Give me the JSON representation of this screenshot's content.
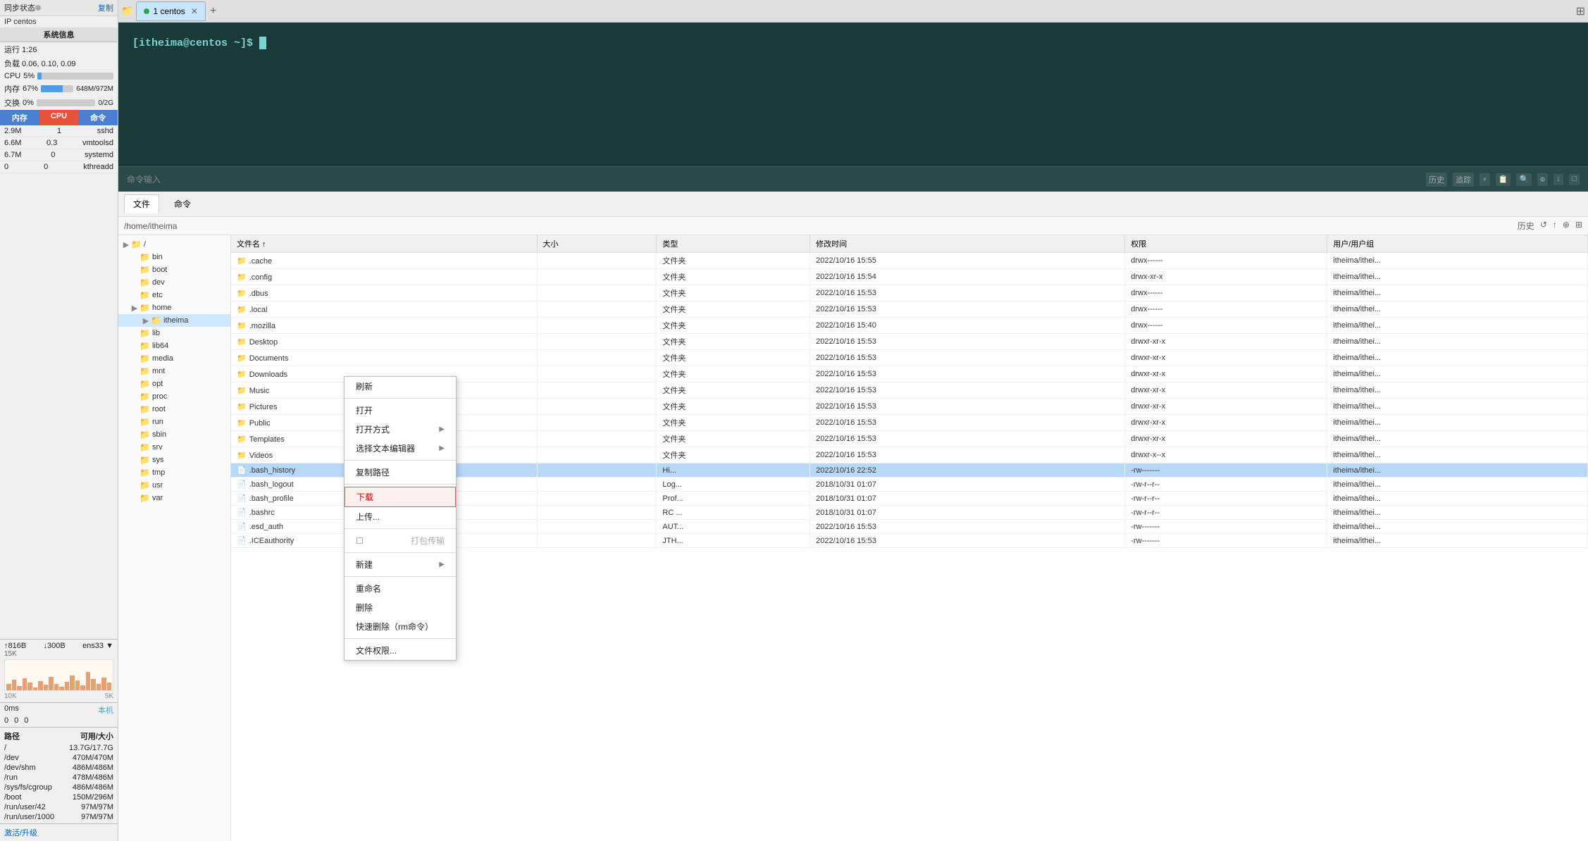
{
  "sidebar": {
    "header": {
      "title": "同步状态",
      "copy_label": "复制",
      "ip_label": "IP centos"
    },
    "sysinfo_label": "系统信息",
    "running": "运行 1:26",
    "load": "负载 0.06, 0.10, 0.09",
    "cpu_label": "CPU",
    "cpu_value": "5%",
    "mem_label": "内存",
    "mem_value": "67%",
    "mem_detail": "648M/972M",
    "swap_label": "交换",
    "swap_value": "0%",
    "swap_detail": "0/2G",
    "tabs": [
      "内存",
      "CPU",
      "命令"
    ],
    "active_tab": "CPU",
    "processes": [
      {
        "mem": "2.9M",
        "cpu": "1",
        "cmd": "sshd"
      },
      {
        "mem": "6.6M",
        "cpu": "0.3",
        "cmd": "vmtoolsd"
      },
      {
        "mem": "6.7M",
        "cpu": "0",
        "cmd": "systemd"
      },
      {
        "mem": "0",
        "cpu": "0",
        "cmd": "kthreadd"
      }
    ],
    "net": {
      "up": "↑816B",
      "down": "↓300B",
      "interface": "ens33",
      "chart_labels": [
        "15K",
        "10K",
        "5K"
      ]
    },
    "ping_label": "0ms",
    "ping_values": [
      "本机",
      "0",
      "0",
      "0"
    ],
    "disk_header": [
      "路径",
      "可用/大小"
    ],
    "disks": [
      {
        "path": "/",
        "size": "13.7G/17.7G"
      },
      {
        "path": "/dev",
        "size": "470M/470M"
      },
      {
        "path": "/dev/shm",
        "size": "486M/486M"
      },
      {
        "path": "/run",
        "size": "478M/486M"
      },
      {
        "path": "/sys/fs/cgroup",
        "size": "486M/486M"
      },
      {
        "path": "/boot",
        "size": "150M/296M"
      },
      {
        "path": "/run/user/42",
        "size": "97M/97M"
      },
      {
        "path": "/run/user/1000",
        "size": "97M/97M"
      }
    ],
    "bottom_label": "激活/升级"
  },
  "tab_bar": {
    "folder_icon": "📁",
    "active_tab": "1 centos",
    "tab_dot_color": "#28a745",
    "add_icon": "+",
    "grid_icon": "⊞"
  },
  "terminal": {
    "prompt": "[itheima@centos ~]$",
    "input_placeholder": "命令输入",
    "actions": {
      "history": "历史",
      "filter": "追踪"
    }
  },
  "file_manager": {
    "tabs": [
      "文件",
      "命令"
    ],
    "active_tab": "文件",
    "breadcrumb": "/home/itheima",
    "toolbar_buttons": [
      "历史",
      "↺",
      "↑",
      "⊕",
      "⊞"
    ],
    "tree": [
      {
        "name": "/",
        "level": 0,
        "toggle": "▶",
        "selected": false
      },
      {
        "name": "bin",
        "level": 1,
        "toggle": "",
        "selected": false
      },
      {
        "name": "boot",
        "level": 1,
        "toggle": "",
        "selected": false
      },
      {
        "name": "dev",
        "level": 1,
        "toggle": "",
        "selected": false
      },
      {
        "name": "etc",
        "level": 1,
        "toggle": "",
        "selected": false
      },
      {
        "name": "home",
        "level": 1,
        "toggle": "▶",
        "selected": false
      },
      {
        "name": "itheima",
        "level": 2,
        "toggle": "▶",
        "selected": true
      },
      {
        "name": "lib",
        "level": 1,
        "toggle": "",
        "selected": false
      },
      {
        "name": "lib64",
        "level": 1,
        "toggle": "",
        "selected": false
      },
      {
        "name": "media",
        "level": 1,
        "toggle": "",
        "selected": false
      },
      {
        "name": "mnt",
        "level": 1,
        "toggle": "",
        "selected": false
      },
      {
        "name": "opt",
        "level": 1,
        "toggle": "",
        "selected": false
      },
      {
        "name": "proc",
        "level": 1,
        "toggle": "",
        "selected": false
      },
      {
        "name": "root",
        "level": 1,
        "toggle": "",
        "selected": false
      },
      {
        "name": "run",
        "level": 1,
        "toggle": "",
        "selected": false
      },
      {
        "name": "sbin",
        "level": 1,
        "toggle": "",
        "selected": false
      },
      {
        "name": "srv",
        "level": 1,
        "toggle": "",
        "selected": false
      },
      {
        "name": "sys",
        "level": 1,
        "toggle": "",
        "selected": false
      },
      {
        "name": "tmp",
        "level": 1,
        "toggle": "",
        "selected": false
      },
      {
        "name": "usr",
        "level": 1,
        "toggle": "",
        "selected": false
      },
      {
        "name": "var",
        "level": 1,
        "toggle": "",
        "selected": false
      }
    ],
    "columns": [
      "文件名 ↑",
      "大小",
      "类型",
      "修改时间",
      "权限",
      "用户/用户组"
    ],
    "files": [
      {
        "name": ".cache",
        "size": "",
        "type": "文件夹",
        "modified": "2022/10/16 15:55",
        "perms": "drwx------",
        "owner": "itheima/ithei...",
        "selected": false
      },
      {
        "name": ".config",
        "size": "",
        "type": "文件夹",
        "modified": "2022/10/16 15:54",
        "perms": "drwx-xr-x",
        "owner": "itheima/ithei...",
        "selected": false
      },
      {
        "name": ".dbus",
        "size": "",
        "type": "文件夹",
        "modified": "2022/10/16 15:53",
        "perms": "drwx------",
        "owner": "itheima/ithei...",
        "selected": false
      },
      {
        "name": ".local",
        "size": "",
        "type": "文件夹",
        "modified": "2022/10/16 15:53",
        "perms": "drwx------",
        "owner": "itheima/ithei...",
        "selected": false
      },
      {
        "name": ".mozilla",
        "size": "",
        "type": "文件夹",
        "modified": "2022/10/16 15:40",
        "perms": "drwx------",
        "owner": "itheima/ithei...",
        "selected": false
      },
      {
        "name": "Desktop",
        "size": "",
        "type": "文件夹",
        "modified": "2022/10/16 15:53",
        "perms": "drwxr-xr-x",
        "owner": "itheima/ithei...",
        "selected": false
      },
      {
        "name": "Documents",
        "size": "",
        "type": "文件夹",
        "modified": "2022/10/16 15:53",
        "perms": "drwxr-xr-x",
        "owner": "itheima/ithei...",
        "selected": false
      },
      {
        "name": "Downloads",
        "size": "",
        "type": "文件夹",
        "modified": "2022/10/16 15:53",
        "perms": "drwxr-xr-x",
        "owner": "itheima/ithei...",
        "selected": false
      },
      {
        "name": "Music",
        "size": "",
        "type": "文件夹",
        "modified": "2022/10/16 15:53",
        "perms": "drwxr-xr-x",
        "owner": "itheima/ithei...",
        "selected": false
      },
      {
        "name": "Pictures",
        "size": "",
        "type": "文件夹",
        "modified": "2022/10/16 15:53",
        "perms": "drwxr-xr-x",
        "owner": "itheima/ithei...",
        "selected": false
      },
      {
        "name": "Public",
        "size": "",
        "type": "文件夹",
        "modified": "2022/10/16 15:53",
        "perms": "drwxr-xr-x",
        "owner": "itheima/ithei...",
        "selected": false
      },
      {
        "name": "Templates",
        "size": "",
        "type": "文件夹",
        "modified": "2022/10/16 15:53",
        "perms": "drwxr-xr-x",
        "owner": "itheima/ithei...",
        "selected": false
      },
      {
        "name": "Videos",
        "size": "",
        "type": "文件夹",
        "modified": "2022/10/16 15:53",
        "perms": "drwxr-x--x",
        "owner": "itheima/ithei...",
        "selected": false
      },
      {
        "name": ".bash_history",
        "size": "",
        "type": "Hi...",
        "modified": "2022/10/16 22:52",
        "perms": "-rw-------",
        "owner": "itheima/ithei...",
        "selected": true
      },
      {
        "name": ".bash_logout",
        "size": "",
        "type": "Log...",
        "modified": "2018/10/31 01:07",
        "perms": "-rw-r--r--",
        "owner": "itheima/ithei...",
        "selected": false
      },
      {
        "name": ".bash_profile",
        "size": "",
        "type": "Prof...",
        "modified": "2018/10/31 01:07",
        "perms": "-rw-r--r--",
        "owner": "itheima/ithei...",
        "selected": false
      },
      {
        "name": ".bashrc",
        "size": "",
        "type": "RC ...",
        "modified": "2018/10/31 01:07",
        "perms": "-rw-r--r--",
        "owner": "itheima/ithei...",
        "selected": false
      },
      {
        "name": ".esd_auth",
        "size": "",
        "type": "AUT...",
        "modified": "2022/10/16 15:53",
        "perms": "-rw-------",
        "owner": "itheima/ithei...",
        "selected": false
      },
      {
        "name": ".ICEauthority",
        "size": "",
        "type": "JTH...",
        "modified": "2022/10/16 15:53",
        "perms": "-rw-------",
        "owner": "itheima/ithei...",
        "selected": false
      }
    ],
    "context_menu": {
      "visible": true,
      "items": [
        {
          "label": "刷新",
          "type": "item",
          "submenu": false,
          "disabled": false,
          "highlighted": false
        },
        {
          "type": "separator"
        },
        {
          "label": "打开",
          "type": "item",
          "submenu": false,
          "disabled": false,
          "highlighted": false
        },
        {
          "label": "打开方式",
          "type": "item",
          "submenu": true,
          "disabled": false,
          "highlighted": false
        },
        {
          "label": "选择文本编辑器",
          "type": "item",
          "submenu": true,
          "disabled": false,
          "highlighted": false
        },
        {
          "type": "separator"
        },
        {
          "label": "复制路径",
          "type": "item",
          "submenu": false,
          "disabled": false,
          "highlighted": false
        },
        {
          "type": "separator"
        },
        {
          "label": "下载",
          "type": "item",
          "submenu": false,
          "disabled": false,
          "highlighted": true
        },
        {
          "label": "上传...",
          "type": "item",
          "submenu": false,
          "disabled": false,
          "highlighted": false
        },
        {
          "type": "separator"
        },
        {
          "label": "打包传输",
          "type": "item",
          "submenu": false,
          "disabled": true,
          "highlighted": false
        },
        {
          "type": "separator"
        },
        {
          "label": "新建",
          "type": "item",
          "submenu": true,
          "disabled": false,
          "highlighted": false
        },
        {
          "type": "separator"
        },
        {
          "label": "重命名",
          "type": "item",
          "submenu": false,
          "disabled": false,
          "highlighted": false
        },
        {
          "label": "删除",
          "type": "item",
          "submenu": false,
          "disabled": false,
          "highlighted": false
        },
        {
          "label": "快速删除（rm命令）",
          "type": "item",
          "submenu": false,
          "disabled": false,
          "highlighted": false
        },
        {
          "type": "separator"
        },
        {
          "label": "文件权限...",
          "type": "item",
          "submenu": false,
          "disabled": false,
          "highlighted": false
        }
      ]
    }
  }
}
